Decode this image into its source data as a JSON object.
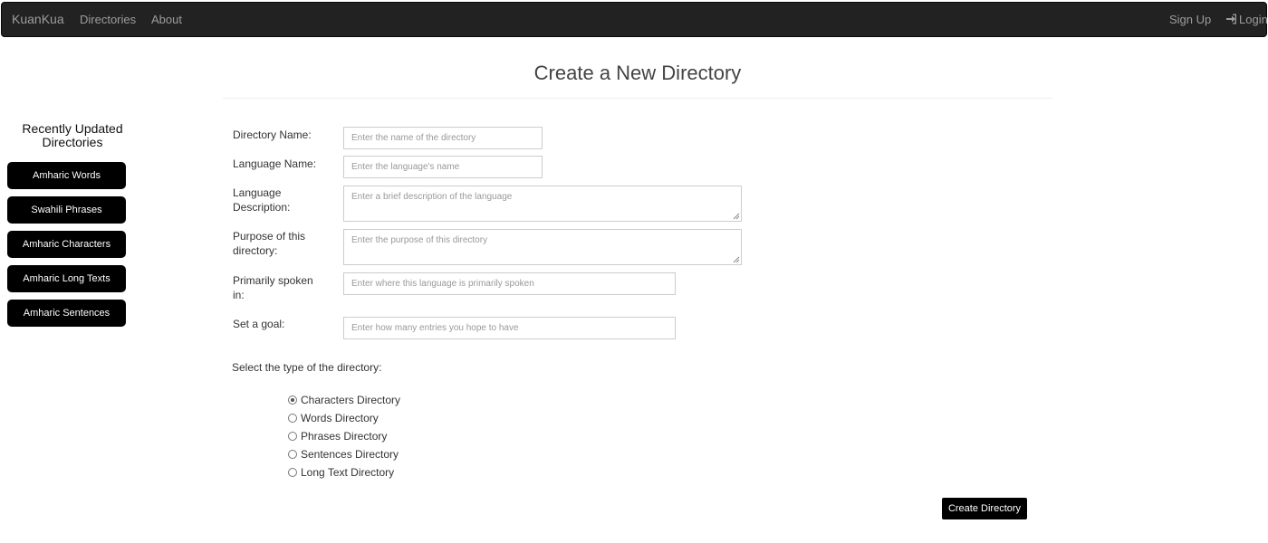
{
  "navbar": {
    "brand": "KuanKua",
    "links": [
      "Directories",
      "About"
    ],
    "sign_up": "Sign Up",
    "login": "Login",
    "login_icon": "log-in-icon"
  },
  "page": {
    "title": "Create a New Directory"
  },
  "sidebar": {
    "title_line1": "Recently Updated",
    "title_line2": "Directories",
    "items": [
      "Amharic Words",
      "Swahili Phrases",
      "Amharic Characters",
      "Amharic Long Texts",
      "Amharic Sentences"
    ]
  },
  "form": {
    "directory_name": {
      "label": "Directory Name:",
      "placeholder": "Enter the name of the directory",
      "value": ""
    },
    "language_name": {
      "label": "Language Name:",
      "placeholder": "Enter the language's name",
      "value": ""
    },
    "language_description": {
      "label_line1": "Language",
      "label_line2": "Description:",
      "placeholder": "Enter a brief description of the language",
      "value": ""
    },
    "purpose": {
      "label_line1": "Purpose of this",
      "label_line2": "directory:",
      "placeholder": "Enter the purpose of this directory",
      "value": ""
    },
    "spoken_in": {
      "label_line1": "Primarily spoken",
      "label_line2": "in:",
      "placeholder": "Enter where this language is primarily spoken",
      "value": ""
    },
    "goal": {
      "label": "Set a goal:",
      "placeholder": "Enter how many entries you hope to have",
      "value": ""
    },
    "type_label": "Select the type of the directory:",
    "types": [
      "Characters Directory",
      "Words Directory",
      "Phrases Directory",
      "Sentences Directory",
      "Long Text Directory"
    ],
    "selected_type": "Characters Directory",
    "submit_label": "Create Directory"
  },
  "colors": {
    "navbar_bg": "#222222",
    "navbar_text": "#9d9d9d",
    "button_bg": "#000000",
    "button_text": "#ffffff"
  }
}
